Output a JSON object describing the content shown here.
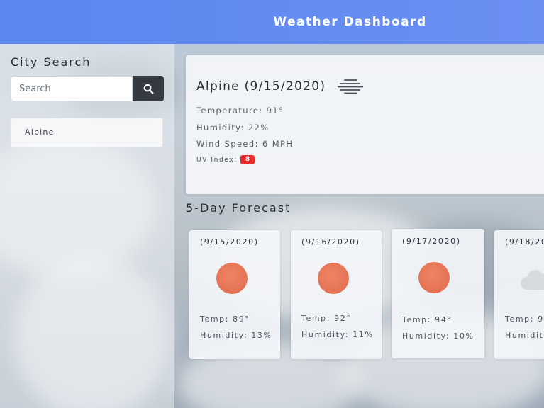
{
  "header": {
    "title": "Weather Dashboard"
  },
  "sidebar": {
    "heading": "City Search",
    "search": {
      "placeholder": "Search",
      "value": "",
      "button_icon": "search-icon"
    },
    "history": [
      {
        "label": "Alpine"
      }
    ]
  },
  "current": {
    "city_line": "Alpine (9/15/2020)",
    "icon": "haze-icon",
    "temperature": "Temperature: 91°",
    "humidity": "Humidity: 22%",
    "wind": "Wind Speed: 6 MPH",
    "uv_label": "UV Index:",
    "uv_value": "8",
    "uv_color": "#ec2a2a"
  },
  "forecast": {
    "title": "5-Day Forecast",
    "days": [
      {
        "date": "(9/15/2020)",
        "icon": "sun-icon",
        "temp": "Temp: 89°",
        "humidity": "Humidity: 13%"
      },
      {
        "date": "(9/16/2020)",
        "icon": "sun-icon",
        "temp": "Temp: 92°",
        "humidity": "Humidity: 11%"
      },
      {
        "date": "(9/17/2020)",
        "icon": "sun-icon",
        "temp": "Temp: 94°",
        "humidity": "Humidity: 10%"
      },
      {
        "date": "(9/18/20",
        "icon": "cloud-icon",
        "temp": "Temp: 9",
        "humidity": "Humidit"
      }
    ]
  },
  "colors": {
    "header": "#6189f0",
    "sun": "#e8765a",
    "search_button": "#343a40"
  }
}
